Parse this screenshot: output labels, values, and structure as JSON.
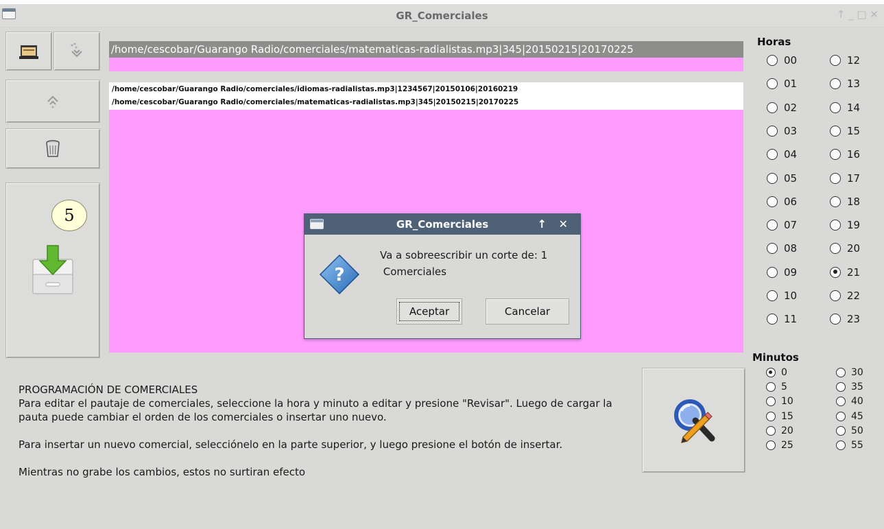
{
  "window": {
    "title": "GR_Comerciales",
    "controls": "↑ _ □ ✕"
  },
  "selected_path": "/home/cescobar/Guarango Radio/comerciales/matematicas-radialistas.mp3|345|20150215|20170225",
  "list": [
    "/home/cescobar/Guarango Radio/comerciales/idiomas-radialistas.mp3|1234567|20150106|20160219",
    "/home/cescobar/Guarango Radio/comerciales/matematicas-radialistas.mp3|345|20150215|20170225"
  ],
  "badge": "5",
  "horas": {
    "label": "Horas",
    "left": [
      "00",
      "01",
      "02",
      "03",
      "04",
      "05",
      "06",
      "07",
      "08",
      "09",
      "10",
      "11"
    ],
    "right": [
      "12",
      "13",
      "14",
      "15",
      "16",
      "17",
      "18",
      "19",
      "20",
      "21",
      "22",
      "23"
    ],
    "selected": "21"
  },
  "minutos": {
    "label": "Minutos",
    "left": [
      "0",
      "5",
      "10",
      "15",
      "20",
      "25"
    ],
    "right": [
      "30",
      "35",
      "40",
      "45",
      "50",
      "55"
    ],
    "selected": "0"
  },
  "description": {
    "title": "PROGRAMACIÓN DE COMERCIALES",
    "p1": "Para editar el pautaje de comerciales, seleccione la hora y minuto a editar y presione \"Revisar\". Luego de cargar la pauta puede cambiar el orden de los comerciales o insertar uno nuevo.",
    "p2": "Para insertar un nuevo comercial, selecciónelo en la parte superior, y luego presione el botón de insertar.",
    "p3": "Mientras no grabe los cambios, estos no surtiran efecto"
  },
  "dialog": {
    "title": "GR_Comerciales",
    "controls": "↑ ✕",
    "message": "Va a sobreescribir un corte de: 1\n Comerciales",
    "ok_label": "Aceptar",
    "cancel_label": "Cancelar"
  },
  "colors": {
    "list_bg": "#ff9bff",
    "path_bg": "#8d8d8b",
    "dialog_title": "#4e6176"
  }
}
